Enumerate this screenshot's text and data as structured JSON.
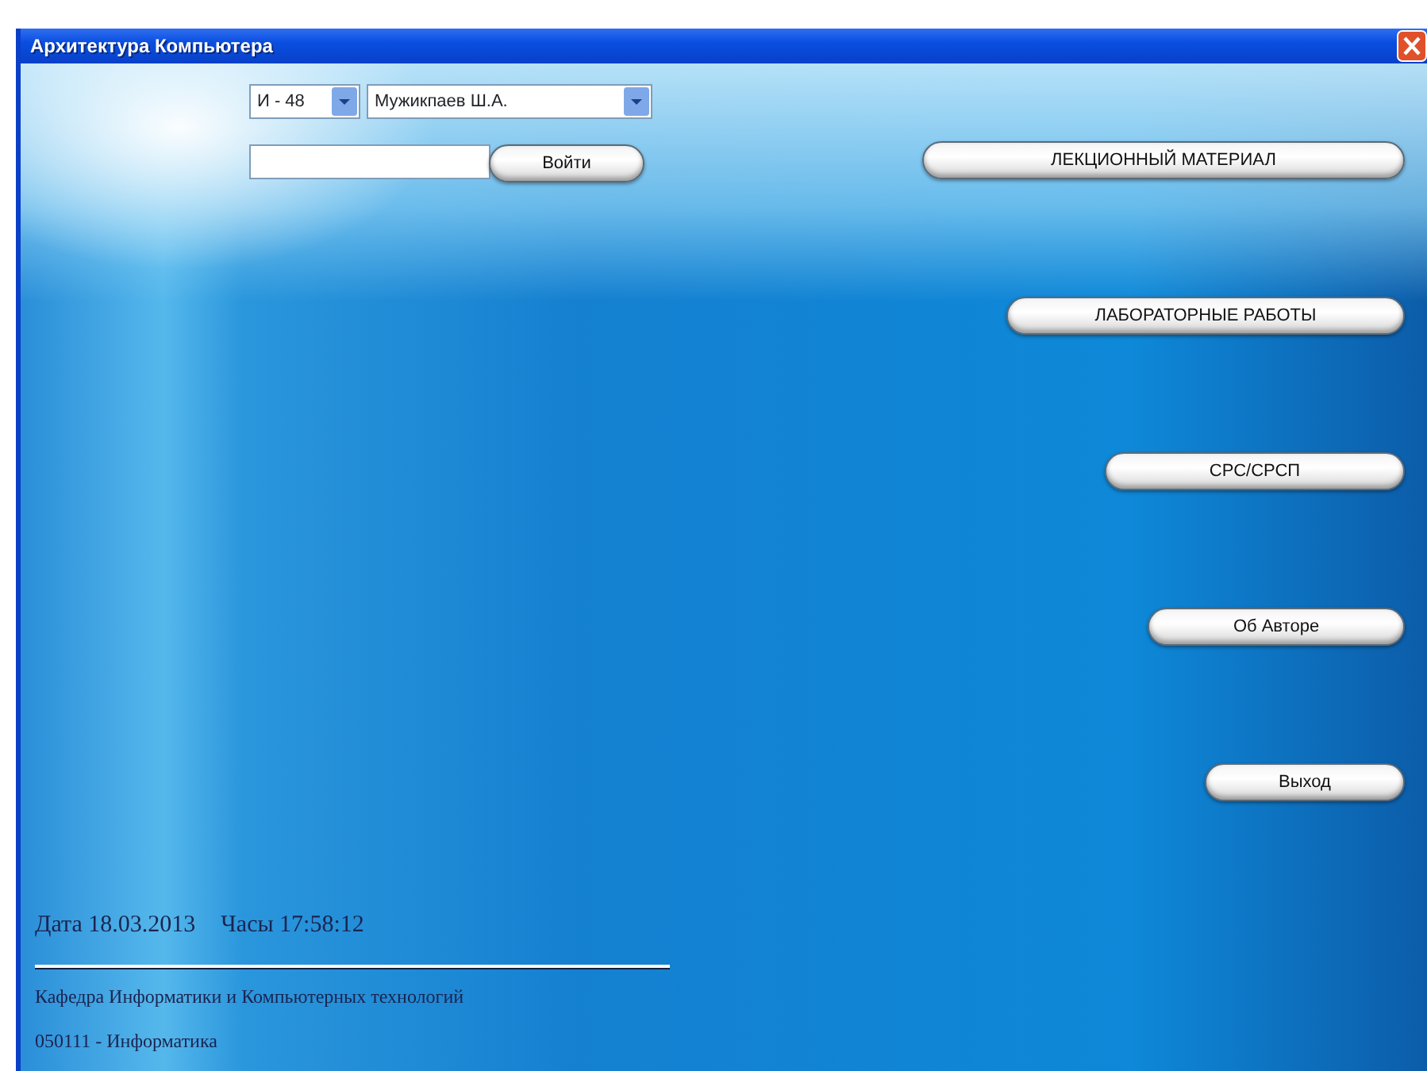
{
  "window": {
    "title": "Архитектура Компьютера"
  },
  "login": {
    "group": {
      "value": "И - 48"
    },
    "student": {
      "value": "Мужикпаев Ш.А."
    },
    "login_button": "Войти"
  },
  "menu_buttons": [
    "ЛЕКЦИОННЫЙ МАТЕРИАЛ",
    "ЛАБОРАТОРНЫЕ РАБОТЫ",
    "СРС/СРСП",
    "Об Авторе",
    "Выход"
  ],
  "status": {
    "date": "Дата 18.03.2013",
    "time": "Часы 17:58:12"
  },
  "footer": [
    "Кафедра Информатики и Компьютерных технологий",
    "050111 - Информатика"
  ]
}
